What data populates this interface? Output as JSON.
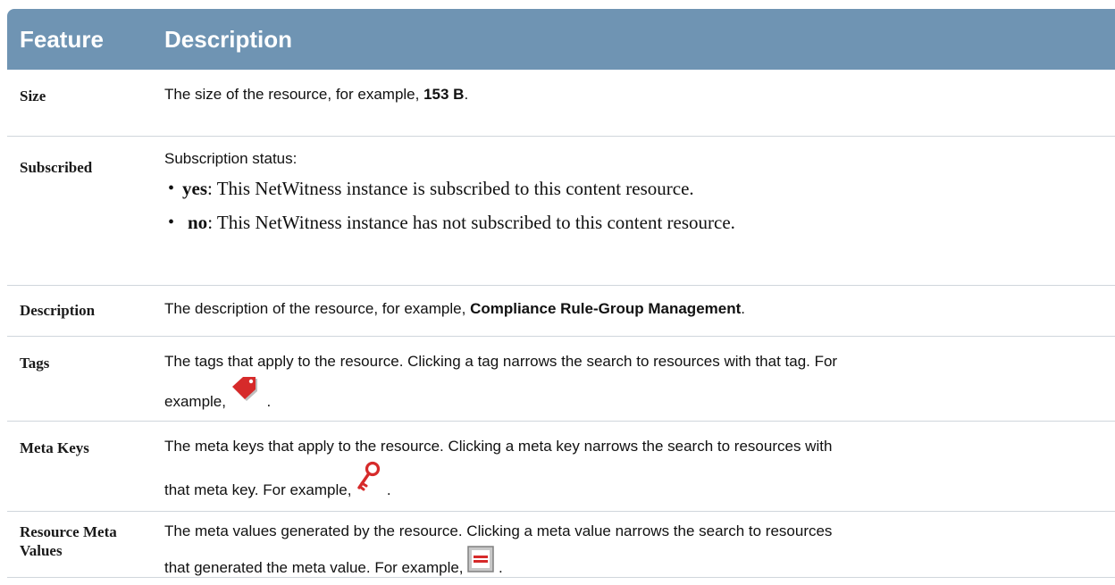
{
  "table": {
    "headers": {
      "feature": "Feature",
      "description": "Description"
    },
    "rows": [
      {
        "feature": "Size",
        "desc_pre": "The size of the resource, for example, ",
        "desc_bold": "153 B",
        "desc_post": "."
      },
      {
        "feature": "Subscribed",
        "desc_intro": "Subscription status:",
        "bullets": [
          {
            "bold": "yes",
            "text": ": This NetWitness instance is subscribed to this content resource."
          },
          {
            "bold": "no",
            "text": ": This NetWitness instance has not subscribed to this content resource."
          }
        ]
      },
      {
        "feature": "Description",
        "desc_pre": "The description of the resource, for example, ",
        "desc_bold": "Compliance Rule-Group Management",
        "desc_post": "."
      },
      {
        "feature": "Tags",
        "line1": "The tags that apply to the resource. Clicking a tag narrows the search to resources with that tag. For",
        "line2": "example,",
        "icon": "red-tag-icon"
      },
      {
        "feature": "Meta Keys",
        "line1": "The meta keys that apply to the resource. Clicking a meta key narrows the search to resources with",
        "line2": "that meta key. For example,",
        "icon": "red-key-icon"
      },
      {
        "feature": "Resource Meta Values",
        "line1": "The meta values generated by the resource. Clicking a meta value narrows the search to resources",
        "line2": "that generated the meta value. For example,",
        "icon": "meta-value-icon"
      }
    ]
  },
  "colors": {
    "header_bg": "#6f94b3",
    "header_text": "#ffffff",
    "icon_red": "#d62a2a"
  }
}
